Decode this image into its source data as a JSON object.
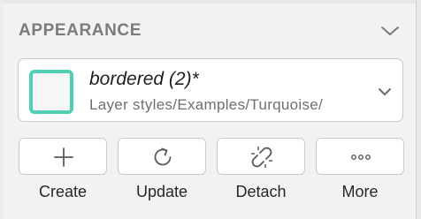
{
  "panel": {
    "section_title": "APPEARANCE",
    "collapse_icon": "chevron-down-icon"
  },
  "layer_style": {
    "name": "bordered (2)*",
    "path": "Layer styles/Examples/Turquoise/",
    "swatch_border_color": "#4fcfb3",
    "dropdown_icon": "chevron-down-icon"
  },
  "actions": [
    {
      "label": "Create",
      "icon": "plus-icon"
    },
    {
      "label": "Update",
      "icon": "refresh-icon"
    },
    {
      "label": "Detach",
      "icon": "broken-link-icon"
    },
    {
      "label": "More",
      "icon": "ellipsis-icon"
    }
  ]
}
